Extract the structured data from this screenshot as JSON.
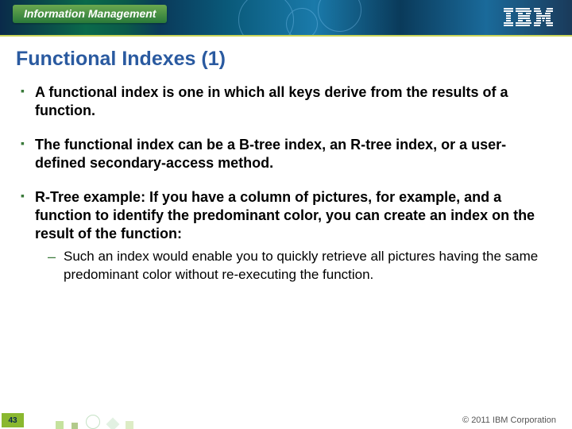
{
  "header": {
    "badge_text": "Information Management",
    "logo_name": "ibm-logo"
  },
  "title": "Functional Indexes (1)",
  "bullets": [
    {
      "text": "A functional index is one in which all keys derive from the results of a function."
    },
    {
      "text": "The functional index can be a B-tree index, an R-tree index, or a user-defined secondary-access method."
    },
    {
      "text": "R-Tree example: If you have a column of pictures, for example, and a function to identify the predominant color, you can create an index on the result of the function:",
      "sub": [
        "Such an index would enable you to quickly retrieve all pictures having the same predominant color without re-executing the function."
      ]
    }
  ],
  "footer": {
    "page_number": "43",
    "copyright": "© 2011 IBM Corporation"
  },
  "colors": {
    "title": "#2a5aa0",
    "bullet_marker": "#3a7a3a",
    "badge_bg": "#4a9a3a"
  }
}
